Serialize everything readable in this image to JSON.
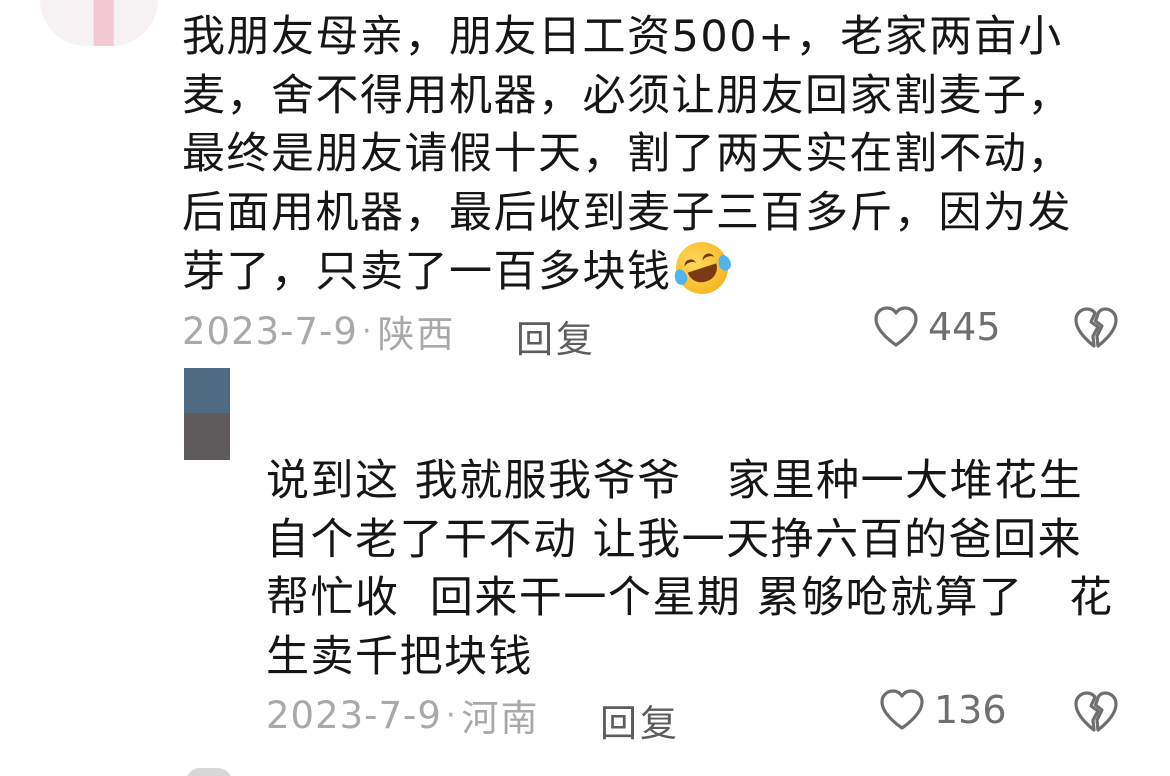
{
  "comments": [
    {
      "text": "我朋友母亲，朋友日工资500+，老家两亩小麦，舍不得用机器，必须让朋友回家割麦子，最终是朋友请假十天，割了两天实在割不动，后面用机器，最后收到麦子三百多斤，因为发芽了，只卖了一百多块钱",
      "emoji": "rolling-laughing-tears-emoji",
      "date": "2023-7-9",
      "location": "陕西",
      "reply_label": "回复",
      "likes": "445"
    },
    {
      "text": "说到这 我就服我爷爷   家里种一大堆花生自个老了干不动 让我一天挣六百的爸回来帮忙收  回来干一个星期 累够呛就算了   花生卖千把块钱",
      "date": "2023-7-9",
      "location": "河南",
      "reply_label": "回复",
      "likes": "136"
    }
  ],
  "separator": "·",
  "colors": {
    "text": "#161616",
    "meta": "#a9a9a9",
    "reply": "#5d5d5d",
    "icon": "#6f6f6f"
  }
}
